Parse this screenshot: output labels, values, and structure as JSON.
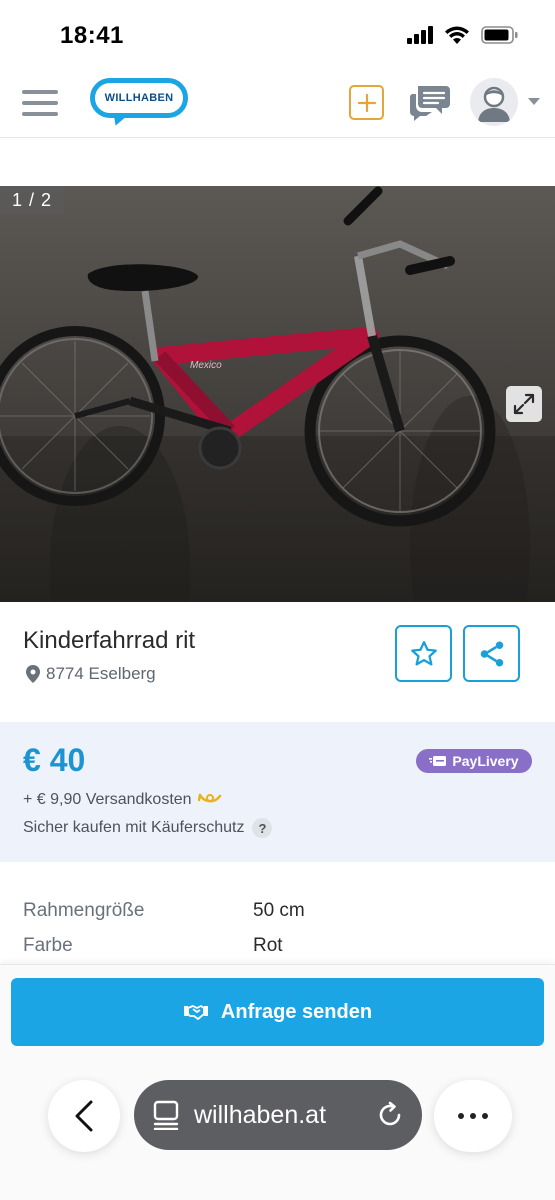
{
  "status_bar": {
    "time": "18:41",
    "icons": [
      "cellular-signal-icon",
      "wifi-icon",
      "battery-icon"
    ]
  },
  "header": {
    "logo_text": "WILLHABEN",
    "icons": [
      "hamburger-menu-icon",
      "add-ad-icon",
      "messages-icon",
      "avatar-icon",
      "chevron-down-icon"
    ]
  },
  "gallery": {
    "counter": "1 / 2",
    "expand_icon": "expand-icon"
  },
  "listing": {
    "title": "Kinderfahrrad rit",
    "location": "8774 Eselberg",
    "location_icon": "map-pin-icon",
    "favorite_icon": "star-icon",
    "share_icon": "share-icon"
  },
  "pricing": {
    "price": "€ 40",
    "paylivery_label": "PayLivery",
    "shipping": "+ € 9,90 Versandkosten",
    "protection": "Sicher kaufen mit Käuferschutz",
    "help_symbol": "?"
  },
  "attributes": [
    {
      "label": "Rahmengröße",
      "value": "50 cm"
    },
    {
      "label": "Farbe",
      "value": "Rot"
    }
  ],
  "cta": {
    "label": "Anfrage senden",
    "icon": "handshake-icon"
  },
  "browser": {
    "url": "willhaben.at",
    "icons": [
      "back-arrow-icon",
      "tabs-icon",
      "reload-icon",
      "more-icon"
    ]
  },
  "colors": {
    "brand_blue": "#1ca5e5",
    "price_blue": "#1d94d2",
    "paylivery_purple": "#8a6fc9",
    "add_orange": "#e4a53a"
  }
}
